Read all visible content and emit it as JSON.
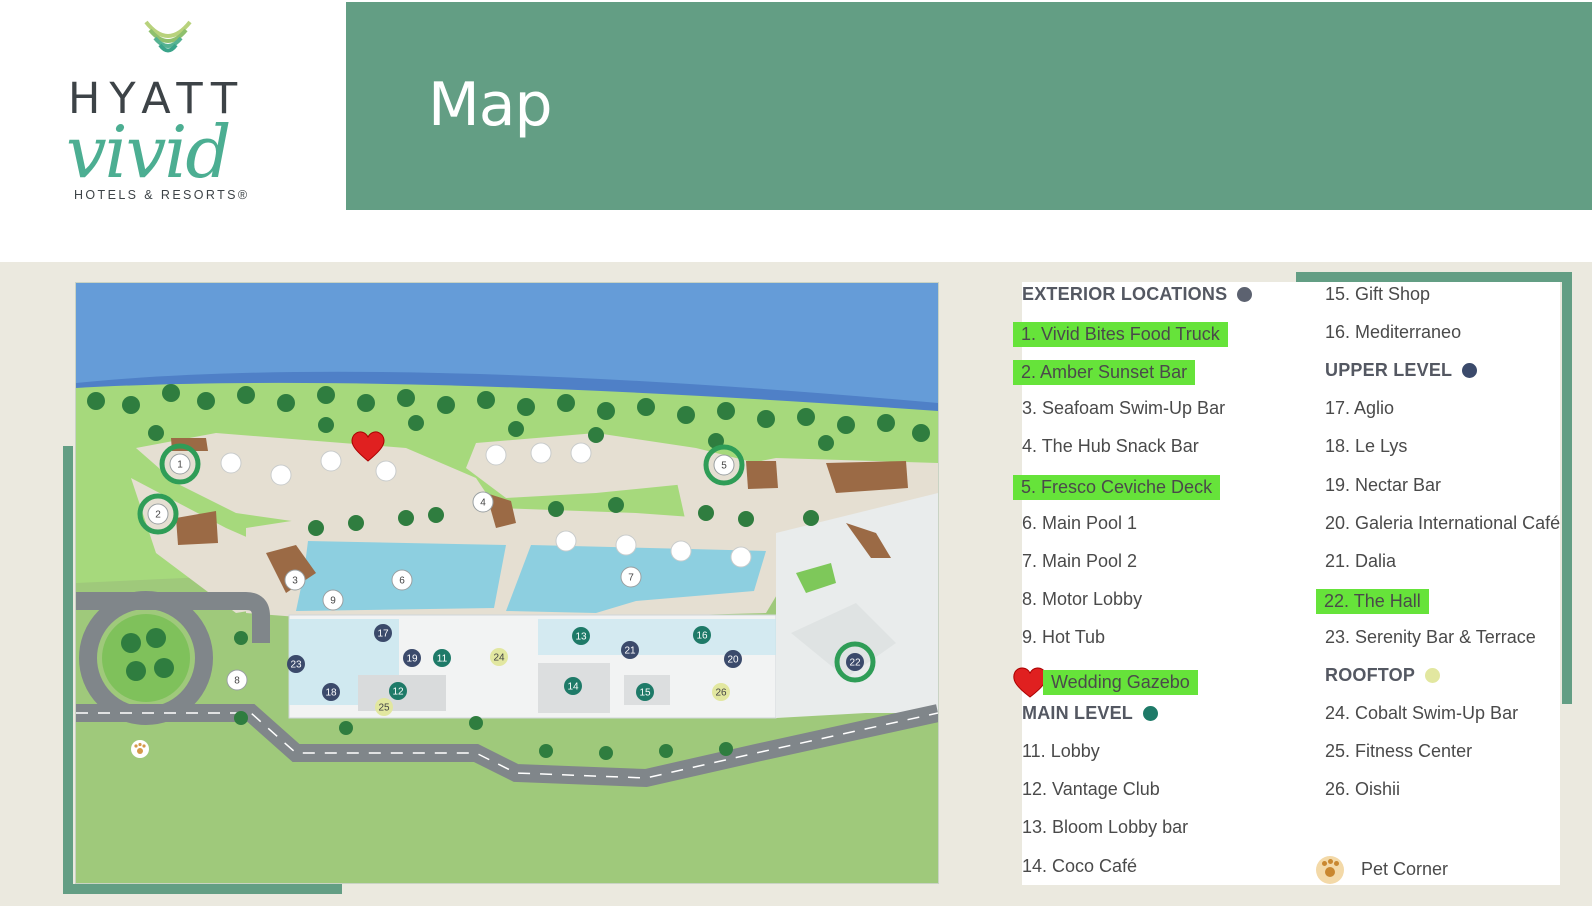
{
  "header": {
    "title": "Map"
  },
  "logo": {
    "brand": "HYATT",
    "script": "vivid",
    "sub": "HOTELS & RESORTS®"
  },
  "legend": {
    "left": [
      {
        "text": "EXTERIOR LOCATIONS",
        "kind": "header",
        "dot_color": "#5c6270"
      },
      {
        "text": "1. Vivid Bites Food Truck",
        "kind": "highlight"
      },
      {
        "text": "2. Amber Sunset Bar",
        "kind": "highlight"
      },
      {
        "text": "3. Seafoam Swim-Up Bar",
        "kind": "item"
      },
      {
        "text": "4. The Hub Snack Bar",
        "kind": "item"
      },
      {
        "text": "5. Fresco Ceviche Deck",
        "kind": "highlight"
      },
      {
        "text": "6. Main Pool 1",
        "kind": "item"
      },
      {
        "text": "7. Main Pool 2",
        "kind": "item"
      },
      {
        "text": "8. Motor Lobby",
        "kind": "item"
      },
      {
        "text": "9. Hot Tub",
        "kind": "item"
      },
      {
        "text": "Wedding Gazebo",
        "kind": "heart"
      },
      {
        "text": "MAIN LEVEL",
        "kind": "header",
        "dot_color": "#1e7a68"
      },
      {
        "text": "11. Lobby",
        "kind": "item"
      },
      {
        "text": "12. Vantage Club",
        "kind": "item"
      },
      {
        "text": "13. Bloom Lobby bar",
        "kind": "item"
      },
      {
        "text": "14. Coco Café",
        "kind": "item"
      }
    ],
    "right": [
      {
        "text": "15. Gift Shop",
        "kind": "item"
      },
      {
        "text": "16. Mediterraneo",
        "kind": "item"
      },
      {
        "text": "UPPER LEVEL",
        "kind": "header",
        "dot_color": "#3b4a6b"
      },
      {
        "text": "17. Aglio",
        "kind": "item"
      },
      {
        "text": "18. Le Lys",
        "kind": "item"
      },
      {
        "text": "19. Nectar Bar",
        "kind": "item"
      },
      {
        "text": "20. Galeria International Café",
        "kind": "item"
      },
      {
        "text": "21. Dalia",
        "kind": "item"
      },
      {
        "text": "22. The Hall",
        "kind": "highlight"
      },
      {
        "text": "23. Serenity Bar & Terrace",
        "kind": "item"
      },
      {
        "text": "ROOFTOP",
        "kind": "header",
        "dot_color": "#e2e7a0"
      },
      {
        "text": "24. Cobalt Swim-Up Bar",
        "kind": "item"
      },
      {
        "text": "25. Fitness Center",
        "kind": "item"
      },
      {
        "text": "26. Oishii",
        "kind": "item"
      },
      {
        "text": "",
        "kind": "spacer"
      },
      {
        "text": "Pet Corner",
        "kind": "paw"
      }
    ]
  },
  "map": {
    "pins": [
      {
        "label": "1",
        "level": "exterior",
        "ring": true
      },
      {
        "label": "2",
        "level": "exterior",
        "ring": true
      },
      {
        "label": "3",
        "level": "exterior"
      },
      {
        "label": "4",
        "level": "exterior"
      },
      {
        "label": "5",
        "level": "exterior",
        "ring": true
      },
      {
        "label": "6",
        "level": "exterior"
      },
      {
        "label": "7",
        "level": "exterior"
      },
      {
        "label": "8",
        "level": "exterior"
      },
      {
        "label": "9",
        "level": "exterior"
      },
      {
        "label": "11",
        "level": "main"
      },
      {
        "label": "12",
        "level": "main"
      },
      {
        "label": "13",
        "level": "main"
      },
      {
        "label": "14",
        "level": "main"
      },
      {
        "label": "15",
        "level": "main"
      },
      {
        "label": "16",
        "level": "main"
      },
      {
        "label": "17",
        "level": "upper"
      },
      {
        "label": "18",
        "level": "upper"
      },
      {
        "label": "19",
        "level": "upper"
      },
      {
        "label": "20",
        "level": "upper"
      },
      {
        "label": "21",
        "level": "upper"
      },
      {
        "label": "22",
        "level": "upper",
        "ring": true
      },
      {
        "label": "23",
        "level": "upper"
      },
      {
        "label": "24",
        "level": "rooftop"
      },
      {
        "label": "25",
        "level": "rooftop"
      },
      {
        "label": "26",
        "level": "rooftop"
      }
    ],
    "colors": {
      "exterior": "#ffffff",
      "main": "#1e7a68",
      "upper": "#3b4a6b",
      "rooftop": "#e2e7a0",
      "ring": "#2f9d57",
      "heart": "#e02020",
      "highlight": "#66e33a",
      "banner": "#639e84"
    }
  }
}
